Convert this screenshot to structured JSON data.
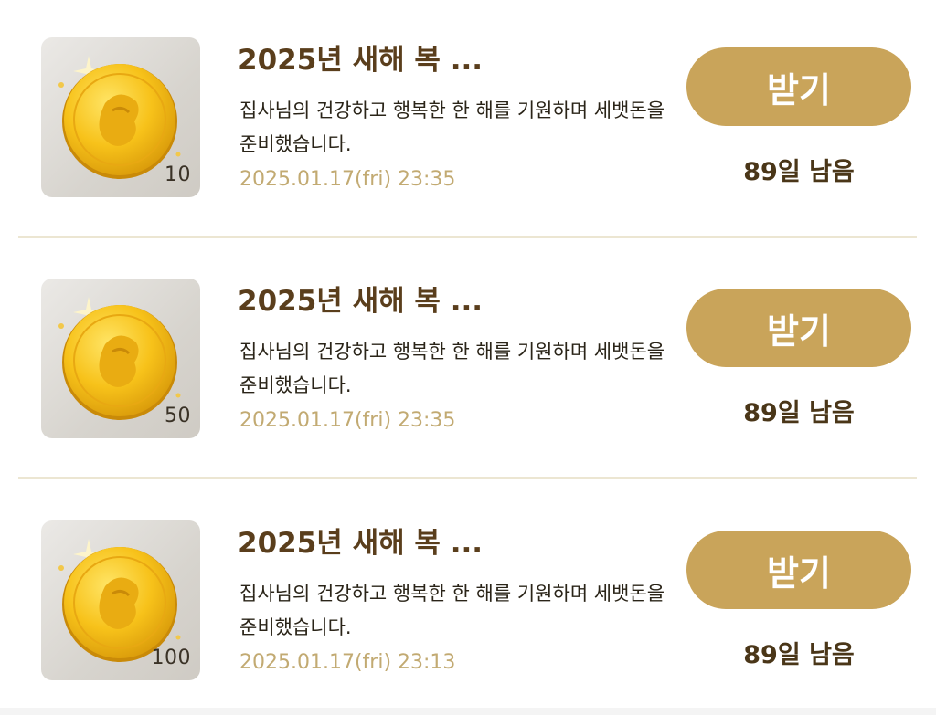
{
  "items": [
    {
      "title": "2025년 새해 복 ...",
      "description": "집사님의 건강하고 행복한 한 해를 기원하며 세뱃돈을 준비했습니다.",
      "date": "2025.01.17(fri) 23:35",
      "quantity": "10",
      "button_label": "받기",
      "remaining": "89일 남음",
      "icon": "gold-coin-icon"
    },
    {
      "title": "2025년 새해 복 ...",
      "description": "집사님의 건강하고 행복한 한 해를 기원하며 세뱃돈을 준비했습니다.",
      "date": "2025.01.17(fri) 23:35",
      "quantity": "50",
      "button_label": "받기",
      "remaining": "89일 남음",
      "icon": "gold-coin-icon"
    },
    {
      "title": "2025년 새해 복 ...",
      "description": "집사님의 건강하고 행복한 한 해를 기원하며 세뱃돈을 준비했습니다.",
      "date": "2025.01.17(fri) 23:13",
      "quantity": "100",
      "button_label": "받기",
      "remaining": "89일 남음",
      "icon": "gold-coin-icon"
    }
  ],
  "colors": {
    "accent": "#c9a45a",
    "title": "#5a3e1c",
    "date": "#c2aa72",
    "divider": "#ece6d2"
  }
}
